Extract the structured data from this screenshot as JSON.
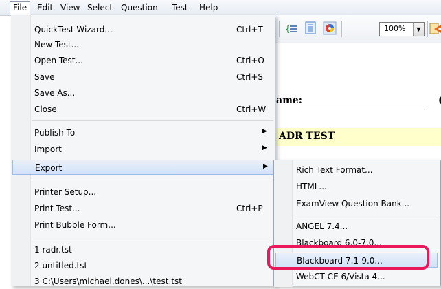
{
  "menubar": {
    "items": [
      {
        "label": "File"
      },
      {
        "label": "Edit"
      },
      {
        "label": "View"
      },
      {
        "label": "Select"
      },
      {
        "label": "Question"
      },
      {
        "label": "Test"
      },
      {
        "label": "Help"
      }
    ]
  },
  "toolbar": {
    "zoom_value": "100%",
    "icons": [
      "list-icon",
      "outline-icon",
      "color-wheel-icon",
      "export-icon"
    ]
  },
  "document": {
    "name_label": "ame:",
    "name_trailing": "(",
    "title": "ADR TEST"
  },
  "file_menu": {
    "items": [
      {
        "label": "QuickTest Wizard...",
        "shortcut": "Ctrl+T"
      },
      {
        "label": "New Test...",
        "shortcut": ""
      },
      {
        "label": "Open Test...",
        "shortcut": "Ctrl+O"
      },
      {
        "label": "Save",
        "shortcut": "Ctrl+S"
      },
      {
        "label": "Save As...",
        "shortcut": ""
      },
      {
        "label": "Close",
        "shortcut": "Ctrl+W"
      },
      {
        "label": "Publish To",
        "shortcut": ""
      },
      {
        "label": "Import",
        "shortcut": ""
      },
      {
        "label": "Export",
        "shortcut": ""
      },
      {
        "label": "Printer Setup...",
        "shortcut": ""
      },
      {
        "label": "Print Test...",
        "shortcut": "Ctrl+P"
      },
      {
        "label": "Print Bubble Form...",
        "shortcut": ""
      },
      {
        "label": "1 radr.tst",
        "shortcut": ""
      },
      {
        "label": "2 untitled.tst",
        "shortcut": ""
      },
      {
        "label": "3 C:\\Users\\michael.dones\\...\\test.tst",
        "shortcut": ""
      }
    ]
  },
  "export_submenu": {
    "items": [
      {
        "label": "Rich Text Format..."
      },
      {
        "label": "HTML..."
      },
      {
        "label": "ExamView Question Bank..."
      },
      {
        "label": "ANGEL 7.4..."
      },
      {
        "label": "Blackboard 6.0-7.0..."
      },
      {
        "label": "Blackboard 7.1-9.0..."
      },
      {
        "label": "WebCT CE 6/Vista 4..."
      }
    ]
  },
  "colors": {
    "highlight_border": "#9ebde3",
    "callout": "#e8185a",
    "title_band": "#ffffcc"
  }
}
